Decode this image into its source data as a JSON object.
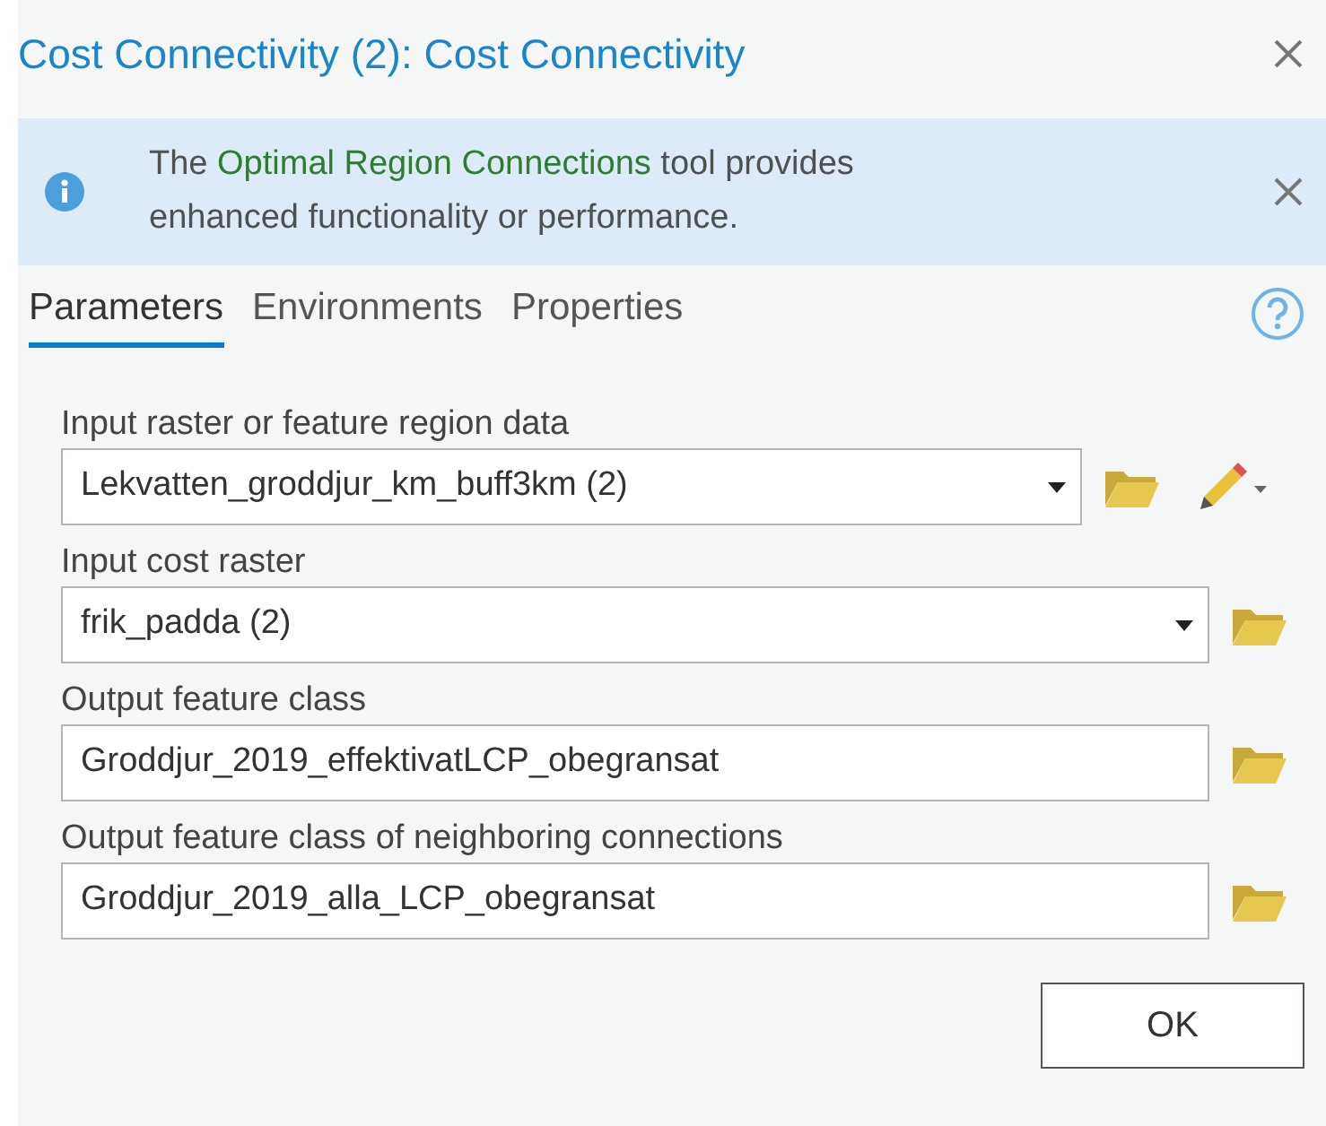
{
  "window": {
    "title": "Cost Connectivity (2): Cost Connectivity"
  },
  "banner": {
    "before": "The ",
    "link": "Optimal Region Connections",
    "after": " tool provides enhanced functionality or performance."
  },
  "tabs": [
    {
      "label": "Parameters",
      "selected": true
    },
    {
      "label": "Environments",
      "selected": false
    },
    {
      "label": "Properties",
      "selected": false
    }
  ],
  "fields": [
    {
      "label": "Input raster or feature region data",
      "value": "Lekvatten_groddjur_km_buff3km (2)",
      "kind": "dropdown",
      "sketch": true
    },
    {
      "label": "Input cost raster",
      "value": "frik_padda (2)",
      "kind": "dropdown",
      "sketch": false
    },
    {
      "label": "Output feature class",
      "value": "Groddjur_2019_effektivatLCP_obegransat",
      "kind": "text",
      "sketch": false
    },
    {
      "label": "Output feature class of neighboring connections",
      "value": "Groddjur_2019_alla_LCP_obegransat",
      "kind": "text",
      "sketch": false
    }
  ],
  "buttons": [
    "OK"
  ]
}
